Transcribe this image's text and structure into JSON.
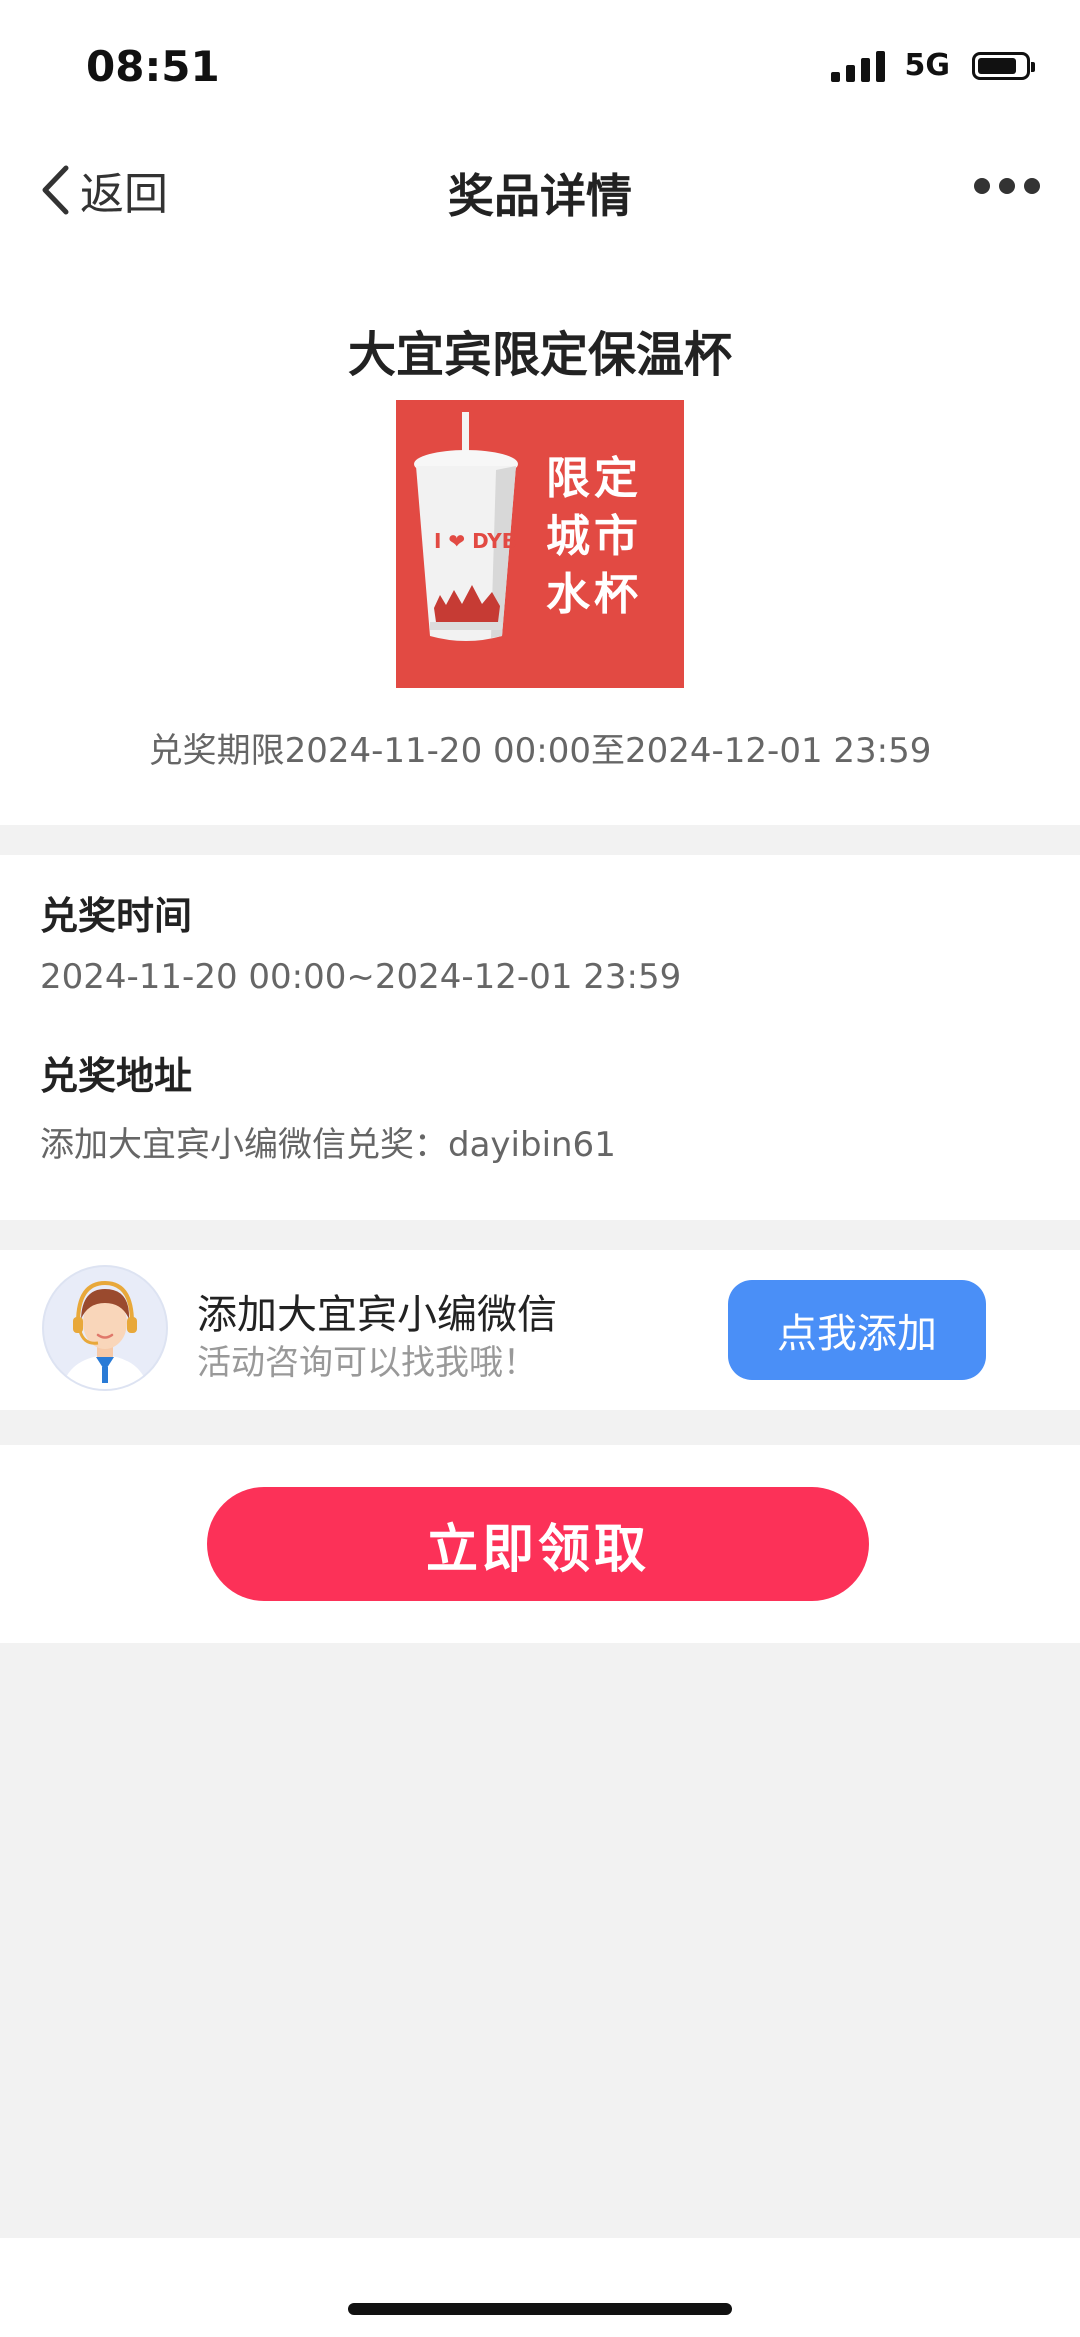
{
  "status_bar": {
    "time": "08:51",
    "network": "5G"
  },
  "nav": {
    "back_label": "返回",
    "title": "奖品详情"
  },
  "prize": {
    "name": "大宜宾限定保温杯",
    "image_tag_lines": [
      "限定",
      "城市",
      "水杯"
    ],
    "image_cup_text": "I ❤ DYB",
    "period": "兑奖期限2024-11-20 00:00至2024-12-01 23:59"
  },
  "redeem_info": {
    "time_heading": "兑奖时间",
    "time_value": "2024-11-20 00:00~2024-12-01 23:59",
    "address_heading": "兑奖地址",
    "address_value": "添加大宜宾小编微信兑奖：dayibin61"
  },
  "contact": {
    "title": "添加大宜宾小编微信",
    "subtitle": "活动咨询可以找我哦！",
    "button_label": "点我添加"
  },
  "claim": {
    "button_label": "立即领取"
  },
  "colors": {
    "claim_button": "#fc3158",
    "add_button": "#4a8ff7",
    "prize_bg": "#e24a43",
    "page_bg": "#f2f2f2"
  }
}
